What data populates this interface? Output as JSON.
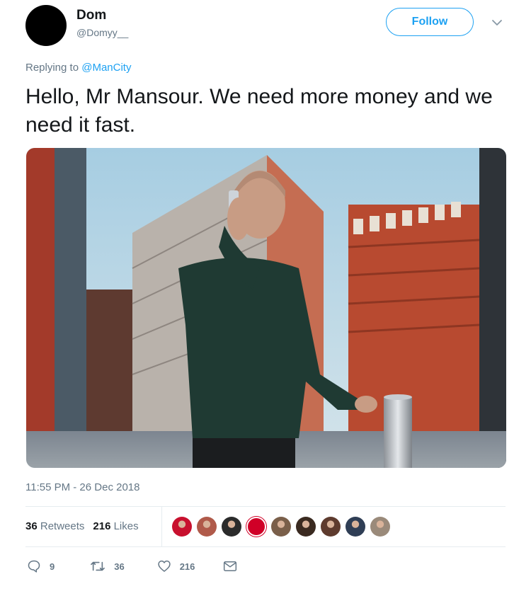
{
  "user": {
    "display_name": "Dom",
    "handle": "@Domyy__"
  },
  "follow_label": "Follow",
  "reply": {
    "prefix": "Replying to",
    "mention": "@ManCity"
  },
  "tweet": {
    "text": "Hello, Mr Mansour. We need more money and we need it fast.",
    "timestamp": "11:55 PM - 26 Dec 2018"
  },
  "stats": {
    "retweets_count": "36",
    "retweets_label": "Retweets",
    "likes_count": "216",
    "likes_label": "Likes"
  },
  "likers": [
    {
      "icon": "liker-avatar",
      "color": "#c8102e"
    },
    {
      "icon": "liker-avatar",
      "color": "#b05a4a"
    },
    {
      "icon": "liker-avatar",
      "color": "#2b2b2b"
    },
    {
      "icon": "liverpool-crest",
      "color": "#d00027"
    },
    {
      "icon": "liker-avatar",
      "color": "#7a5f4a"
    },
    {
      "icon": "liker-avatar",
      "color": "#3a2a20"
    },
    {
      "icon": "liker-avatar",
      "color": "#5e3b2e"
    },
    {
      "icon": "liker-avatar",
      "color": "#2f3e55"
    },
    {
      "icon": "liker-avatar",
      "color": "#9a8a7a"
    }
  ],
  "actions": {
    "replies": "9",
    "retweets": "36",
    "likes": "216"
  },
  "colors": {
    "accent": "#1da1f2",
    "muted": "#657786",
    "text": "#14171a",
    "divider": "#e6ecf0"
  }
}
